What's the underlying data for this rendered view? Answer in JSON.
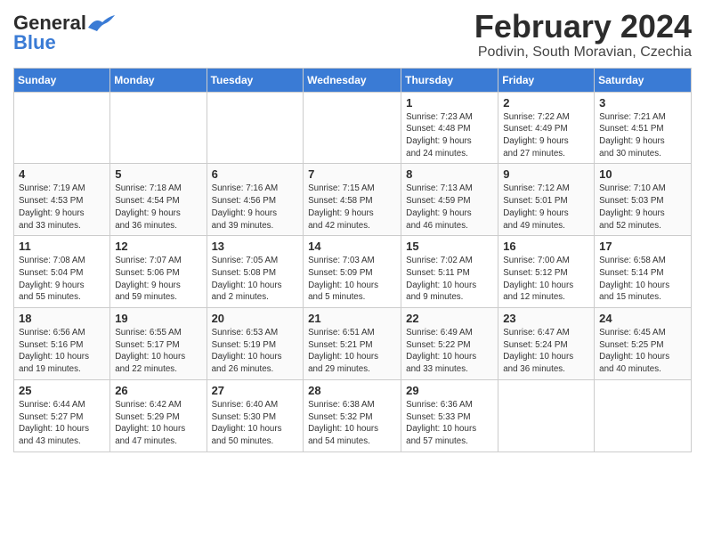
{
  "header": {
    "logo_general": "General",
    "logo_blue": "Blue",
    "month_title": "February 2024",
    "location": "Podivin, South Moravian, Czechia"
  },
  "days_of_week": [
    "Sunday",
    "Monday",
    "Tuesday",
    "Wednesday",
    "Thursday",
    "Friday",
    "Saturday"
  ],
  "weeks": [
    [
      {
        "day": "",
        "info": ""
      },
      {
        "day": "",
        "info": ""
      },
      {
        "day": "",
        "info": ""
      },
      {
        "day": "",
        "info": ""
      },
      {
        "day": "1",
        "info": "Sunrise: 7:23 AM\nSunset: 4:48 PM\nDaylight: 9 hours\nand 24 minutes."
      },
      {
        "day": "2",
        "info": "Sunrise: 7:22 AM\nSunset: 4:49 PM\nDaylight: 9 hours\nand 27 minutes."
      },
      {
        "day": "3",
        "info": "Sunrise: 7:21 AM\nSunset: 4:51 PM\nDaylight: 9 hours\nand 30 minutes."
      }
    ],
    [
      {
        "day": "4",
        "info": "Sunrise: 7:19 AM\nSunset: 4:53 PM\nDaylight: 9 hours\nand 33 minutes."
      },
      {
        "day": "5",
        "info": "Sunrise: 7:18 AM\nSunset: 4:54 PM\nDaylight: 9 hours\nand 36 minutes."
      },
      {
        "day": "6",
        "info": "Sunrise: 7:16 AM\nSunset: 4:56 PM\nDaylight: 9 hours\nand 39 minutes."
      },
      {
        "day": "7",
        "info": "Sunrise: 7:15 AM\nSunset: 4:58 PM\nDaylight: 9 hours\nand 42 minutes."
      },
      {
        "day": "8",
        "info": "Sunrise: 7:13 AM\nSunset: 4:59 PM\nDaylight: 9 hours\nand 46 minutes."
      },
      {
        "day": "9",
        "info": "Sunrise: 7:12 AM\nSunset: 5:01 PM\nDaylight: 9 hours\nand 49 minutes."
      },
      {
        "day": "10",
        "info": "Sunrise: 7:10 AM\nSunset: 5:03 PM\nDaylight: 9 hours\nand 52 minutes."
      }
    ],
    [
      {
        "day": "11",
        "info": "Sunrise: 7:08 AM\nSunset: 5:04 PM\nDaylight: 9 hours\nand 55 minutes."
      },
      {
        "day": "12",
        "info": "Sunrise: 7:07 AM\nSunset: 5:06 PM\nDaylight: 9 hours\nand 59 minutes."
      },
      {
        "day": "13",
        "info": "Sunrise: 7:05 AM\nSunset: 5:08 PM\nDaylight: 10 hours\nand 2 minutes."
      },
      {
        "day": "14",
        "info": "Sunrise: 7:03 AM\nSunset: 5:09 PM\nDaylight: 10 hours\nand 5 minutes."
      },
      {
        "day": "15",
        "info": "Sunrise: 7:02 AM\nSunset: 5:11 PM\nDaylight: 10 hours\nand 9 minutes."
      },
      {
        "day": "16",
        "info": "Sunrise: 7:00 AM\nSunset: 5:12 PM\nDaylight: 10 hours\nand 12 minutes."
      },
      {
        "day": "17",
        "info": "Sunrise: 6:58 AM\nSunset: 5:14 PM\nDaylight: 10 hours\nand 15 minutes."
      }
    ],
    [
      {
        "day": "18",
        "info": "Sunrise: 6:56 AM\nSunset: 5:16 PM\nDaylight: 10 hours\nand 19 minutes."
      },
      {
        "day": "19",
        "info": "Sunrise: 6:55 AM\nSunset: 5:17 PM\nDaylight: 10 hours\nand 22 minutes."
      },
      {
        "day": "20",
        "info": "Sunrise: 6:53 AM\nSunset: 5:19 PM\nDaylight: 10 hours\nand 26 minutes."
      },
      {
        "day": "21",
        "info": "Sunrise: 6:51 AM\nSunset: 5:21 PM\nDaylight: 10 hours\nand 29 minutes."
      },
      {
        "day": "22",
        "info": "Sunrise: 6:49 AM\nSunset: 5:22 PM\nDaylight: 10 hours\nand 33 minutes."
      },
      {
        "day": "23",
        "info": "Sunrise: 6:47 AM\nSunset: 5:24 PM\nDaylight: 10 hours\nand 36 minutes."
      },
      {
        "day": "24",
        "info": "Sunrise: 6:45 AM\nSunset: 5:25 PM\nDaylight: 10 hours\nand 40 minutes."
      }
    ],
    [
      {
        "day": "25",
        "info": "Sunrise: 6:44 AM\nSunset: 5:27 PM\nDaylight: 10 hours\nand 43 minutes."
      },
      {
        "day": "26",
        "info": "Sunrise: 6:42 AM\nSunset: 5:29 PM\nDaylight: 10 hours\nand 47 minutes."
      },
      {
        "day": "27",
        "info": "Sunrise: 6:40 AM\nSunset: 5:30 PM\nDaylight: 10 hours\nand 50 minutes."
      },
      {
        "day": "28",
        "info": "Sunrise: 6:38 AM\nSunset: 5:32 PM\nDaylight: 10 hours\nand 54 minutes."
      },
      {
        "day": "29",
        "info": "Sunrise: 6:36 AM\nSunset: 5:33 PM\nDaylight: 10 hours\nand 57 minutes."
      },
      {
        "day": "",
        "info": ""
      },
      {
        "day": "",
        "info": ""
      }
    ]
  ]
}
